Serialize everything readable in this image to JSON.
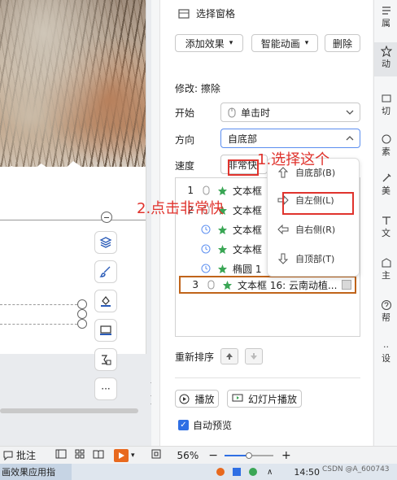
{
  "task_pane": {
    "selection_pane": "选择窗格",
    "add_effect": "添加效果",
    "smart_animation": "智能动画",
    "delete": "删除",
    "modify_label": "修改: 擦除",
    "start_label": "开始",
    "start_value": "单击时",
    "direction_label": "方向",
    "direction_value": "自底部",
    "speed_label": "速度",
    "speed_value": "非常快",
    "reorder_label": "重新排序",
    "play": "播放",
    "slideshow": "幻灯片播放",
    "auto_preview": "自动预览"
  },
  "anim_list": [
    {
      "num": "1",
      "text": "文本框"
    },
    {
      "num": "2",
      "text": "文本框"
    },
    {
      "num": "",
      "text": "文本框"
    },
    {
      "num": "",
      "text": "文本框"
    },
    {
      "num": "",
      "text": "椭圆 1"
    },
    {
      "num": "3",
      "text": "文本框 16: 云南动植..."
    }
  ],
  "direction_menu": [
    {
      "label": "自底部(B)",
      "icon": "arrow-up-icon"
    },
    {
      "label": "自左侧(L)",
      "icon": "arrow-right-icon"
    },
    {
      "label": "自右侧(R)",
      "icon": "arrow-left-icon"
    },
    {
      "label": "自顶部(T)",
      "icon": "arrow-down-icon"
    }
  ],
  "annotations": {
    "step1": "1.选择这个",
    "step2": "2.点击非常快"
  },
  "sidebar": [
    "属",
    "动",
    "切",
    "素",
    "美",
    "文",
    "主",
    "帮",
    "设"
  ],
  "status_bar": {
    "comment": "批注",
    "zoom": "56%",
    "time": "14:50",
    "watermark": "CSDN @A_600743"
  },
  "taskbar": {
    "title": "画效果应用指"
  },
  "colors": {
    "accent": "#2f6fe4",
    "annotation": "#e0332d",
    "selected_row": "#c0641a",
    "play_orange": "#e8691e"
  }
}
